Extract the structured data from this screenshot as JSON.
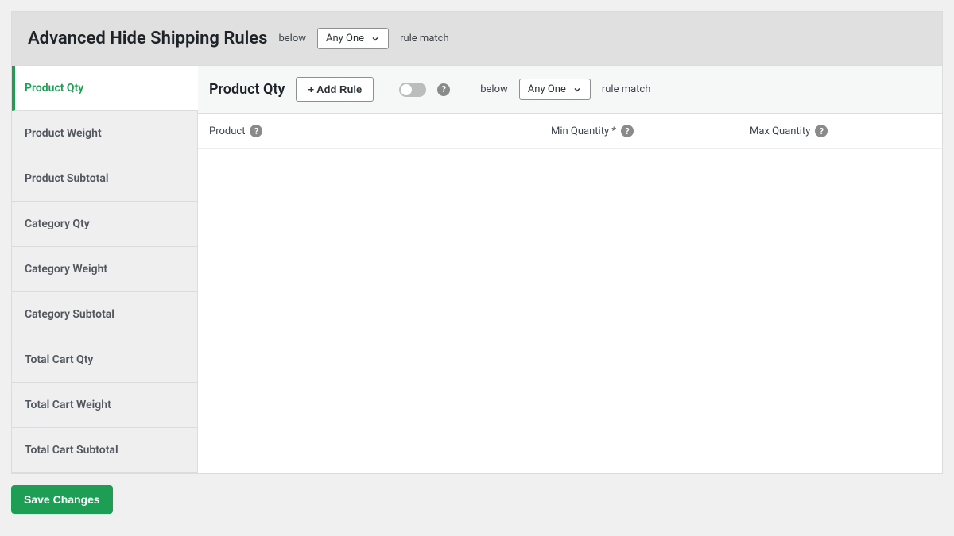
{
  "header": {
    "title": "Advanced Hide Shipping Rules",
    "below": "below",
    "select_value": "Any One",
    "rule_match": "rule match"
  },
  "sidebar": {
    "items": [
      {
        "label": "Product Qty",
        "active": true
      },
      {
        "label": "Product Weight",
        "active": false
      },
      {
        "label": "Product Subtotal",
        "active": false
      },
      {
        "label": "Category Qty",
        "active": false
      },
      {
        "label": "Category Weight",
        "active": false
      },
      {
        "label": "Category Subtotal",
        "active": false
      },
      {
        "label": "Total Cart Qty",
        "active": false
      },
      {
        "label": "Total Cart Weight",
        "active": false
      },
      {
        "label": "Total Cart Subtotal",
        "active": false
      }
    ]
  },
  "content": {
    "title": "Product Qty",
    "add_rule_label": "+ Add Rule",
    "below": "below",
    "select_value": "Any One",
    "rule_match": "rule match",
    "columns": {
      "product": "Product",
      "min_qty": "Min Quantity *",
      "max_qty": "Max Quantity"
    }
  },
  "footer": {
    "save_label": "Save Changes"
  },
  "help_char": "?"
}
